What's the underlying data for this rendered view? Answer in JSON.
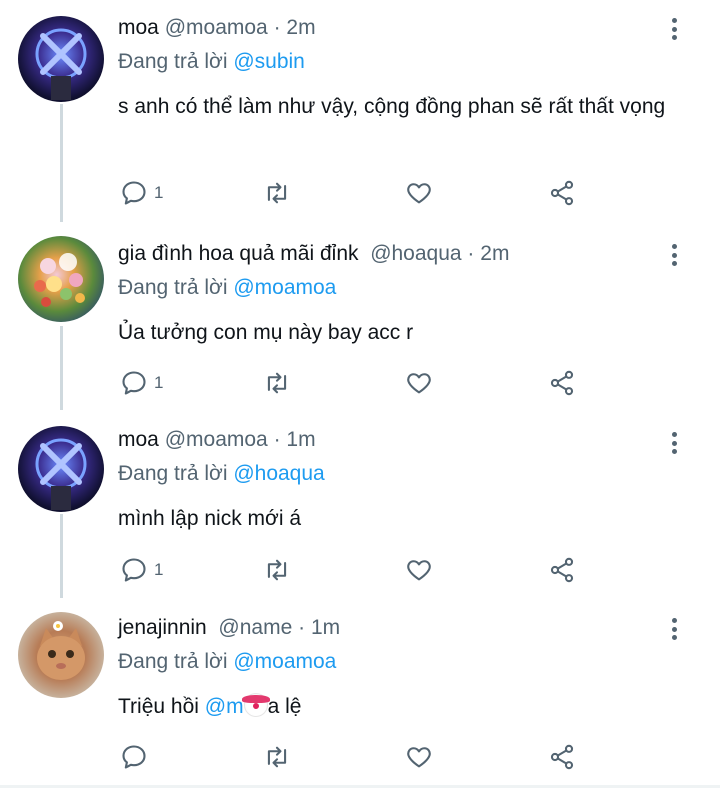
{
  "tweets": [
    {
      "name": "moa",
      "handle": "@moamoa",
      "time": "2m",
      "reply_prefix": "Đang trả lời ",
      "reply_to": "@subin",
      "text": "s anh có thể làm như vậy,  cộng đồng phan sẽ rất thất vọng",
      "reply_count": "1",
      "avatar_icon": "lightstick-avatar"
    },
    {
      "name": "gia đình hoa quả mãi đỉnk",
      "handle": "@hoaqua",
      "time": "2m",
      "reply_prefix": "Đang trả lời ",
      "reply_to": "@moamoa",
      "text": "Ủa tưởng con mụ này bay acc r",
      "reply_count": "1",
      "avatar_icon": "flower-bouquet-avatar"
    },
    {
      "name": "moa",
      "handle": "@moamoa",
      "time": "1m",
      "reply_prefix": "Đang trả lời ",
      "reply_to": "@hoaqua",
      "text": "mình lập nick mới á",
      "reply_count": "1",
      "avatar_icon": "lightstick-avatar"
    },
    {
      "name": "jenajinnin",
      "handle": "@name",
      "time": "1m",
      "reply_prefix": "Đang trả lời ",
      "reply_to": "@moamoa",
      "text_before": "Triệu hồi ",
      "text_mention": "@m",
      "text_after": "a lệ",
      "emoji": "clown-face",
      "reply_count": "",
      "avatar_icon": "cat-avatar"
    }
  ],
  "separator": " · ",
  "colors": {
    "accent": "#1d9bf0",
    "muted": "#536471",
    "text": "#0f1419",
    "thread": "#cfd9de"
  }
}
